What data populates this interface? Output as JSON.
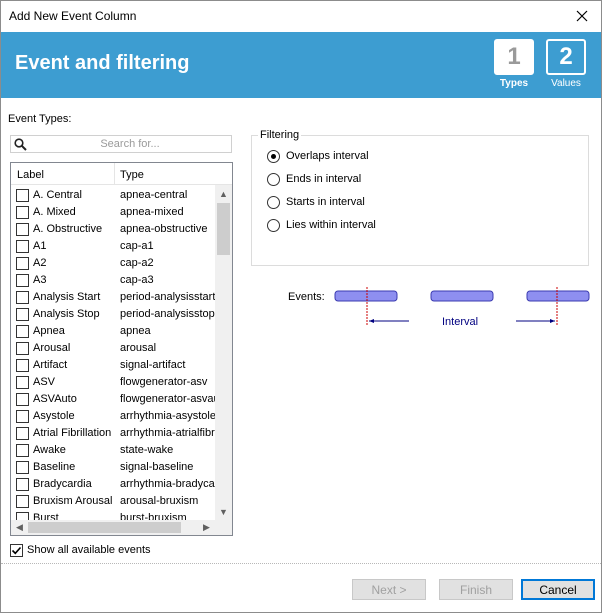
{
  "window": {
    "title": "Add New Event Column"
  },
  "banner": {
    "heading": "Event and filtering",
    "steps": [
      {
        "number": "1",
        "label": "Types"
      },
      {
        "number": "2",
        "label": "Values"
      }
    ]
  },
  "event_types": {
    "label": "Event Types:",
    "search_placeholder": "Search for...",
    "columns": {
      "label": "Label",
      "type": "Type"
    },
    "rows": [
      {
        "label": "A. Central",
        "type": "apnea-central"
      },
      {
        "label": "A. Mixed",
        "type": "apnea-mixed"
      },
      {
        "label": "A. Obstructive",
        "type": "apnea-obstructive"
      },
      {
        "label": "A1",
        "type": "cap-a1"
      },
      {
        "label": "A2",
        "type": "cap-a2"
      },
      {
        "label": "A3",
        "type": "cap-a3"
      },
      {
        "label": "Analysis Start",
        "type": "period-analysisstart"
      },
      {
        "label": "Analysis Stop",
        "type": "period-analysisstop"
      },
      {
        "label": "Apnea",
        "type": "apnea"
      },
      {
        "label": "Arousal",
        "type": "arousal"
      },
      {
        "label": "Artifact",
        "type": "signal-artifact"
      },
      {
        "label": "ASV",
        "type": "flowgenerator-asv"
      },
      {
        "label": "ASVAuto",
        "type": "flowgenerator-asvauto"
      },
      {
        "label": "Asystole",
        "type": "arrhythmia-asystole"
      },
      {
        "label": "Atrial Fibrillation",
        "type": "arrhythmia-atrialfibrillation"
      },
      {
        "label": "Awake",
        "type": "state-wake"
      },
      {
        "label": "Baseline",
        "type": "signal-baseline"
      },
      {
        "label": "Bradycardia",
        "type": "arrhythmia-bradycardia"
      },
      {
        "label": "Bruxism Arousal",
        "type": "arousal-bruxism"
      },
      {
        "label": "Burst",
        "type": "burst-bruxism"
      }
    ],
    "show_all_label": "Show all available events",
    "show_all_checked": true
  },
  "filtering": {
    "legend": "Filtering",
    "options": [
      {
        "label": "Overlaps interval",
        "selected": true
      },
      {
        "label": "Ends in interval",
        "selected": false
      },
      {
        "label": "Starts in interval",
        "selected": false
      },
      {
        "label": "Lies within interval",
        "selected": false
      }
    ],
    "diagram": {
      "events_label": "Events:",
      "interval_label": "Interval"
    }
  },
  "buttons": {
    "next": "Next >",
    "finish": "Finish",
    "cancel": "Cancel"
  },
  "colors": {
    "banner": "#3d9dd1",
    "event_bar": "#8e8ff0",
    "interval_marker": "#cc0000",
    "interval_arrow": "#000080"
  }
}
